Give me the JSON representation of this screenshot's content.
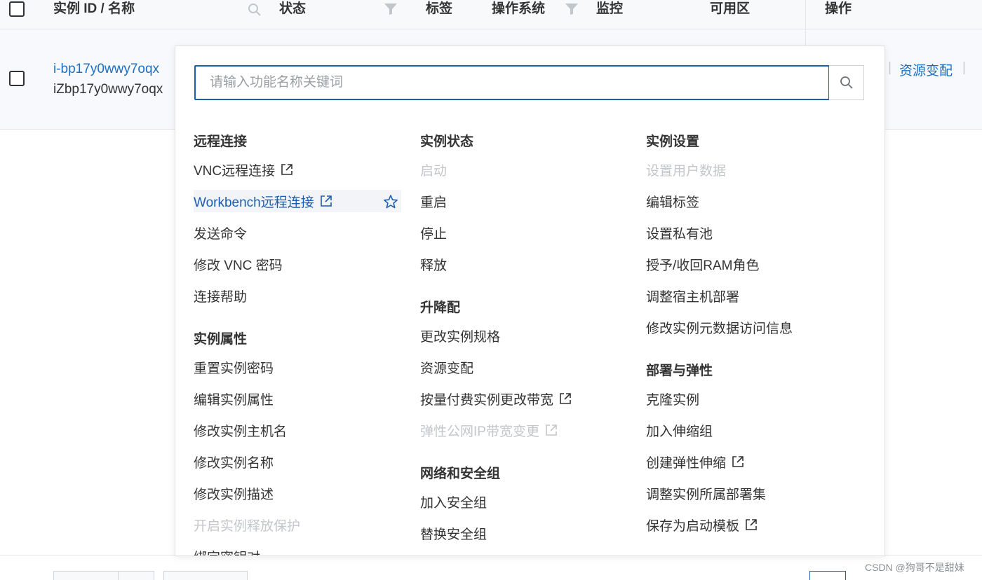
{
  "table": {
    "columns": {
      "id_name": "实例 ID / 名称",
      "status": "状态",
      "tags": "标签",
      "os": "操作系统",
      "monitor": "监控",
      "zone": "可用区",
      "actions": "操作"
    },
    "row": {
      "instance_id": "i-bp17y0wwy7oqx",
      "instance_name": "iZbp17y0wwy7oqx",
      "action_link": "资源变配",
      "separator": "|"
    }
  },
  "search": {
    "placeholder": "请输入功能名称关键词"
  },
  "menu": {
    "remote": {
      "title": "远程连接",
      "items": [
        "VNC远程连接",
        "Workbench远程连接",
        "发送命令",
        "修改 VNC 密码",
        "连接帮助"
      ]
    },
    "props": {
      "title": "实例属性",
      "items": [
        "重置实例密码",
        "编辑实例属性",
        "修改实例主机名",
        "修改实例名称",
        "修改实例描述",
        "开启实例释放保护",
        "绑定密钥对"
      ]
    },
    "state": {
      "title": "实例状态",
      "items": [
        "启动",
        "重启",
        "停止",
        "释放"
      ]
    },
    "spec": {
      "title": "升降配",
      "items": [
        "更改实例规格",
        "资源变配",
        "按量付费实例更改带宽",
        "弹性公网IP带宽变更"
      ]
    },
    "network": {
      "title": "网络和安全组",
      "items": [
        "加入安全组",
        "替换安全组"
      ]
    },
    "settings": {
      "title": "实例设置",
      "items": [
        "设置用户数据",
        "编辑标签",
        "设置私有池",
        "授予/收回RAM角色",
        "调整宿主机部署",
        "修改实例元数据访问信息"
      ]
    },
    "deploy": {
      "title": "部署与弹性",
      "items": [
        "克隆实例",
        "加入伸缩组",
        "创建弹性伸缩",
        "调整实例所属部署集",
        "保存为启动模板"
      ]
    }
  },
  "watermark": "CSDN @狗哥不是甜妹",
  "colors": {
    "link": "#1b6fc4",
    "accent": "#1b5db0",
    "disabled": "#c3c6ca",
    "text": "#333333"
  }
}
